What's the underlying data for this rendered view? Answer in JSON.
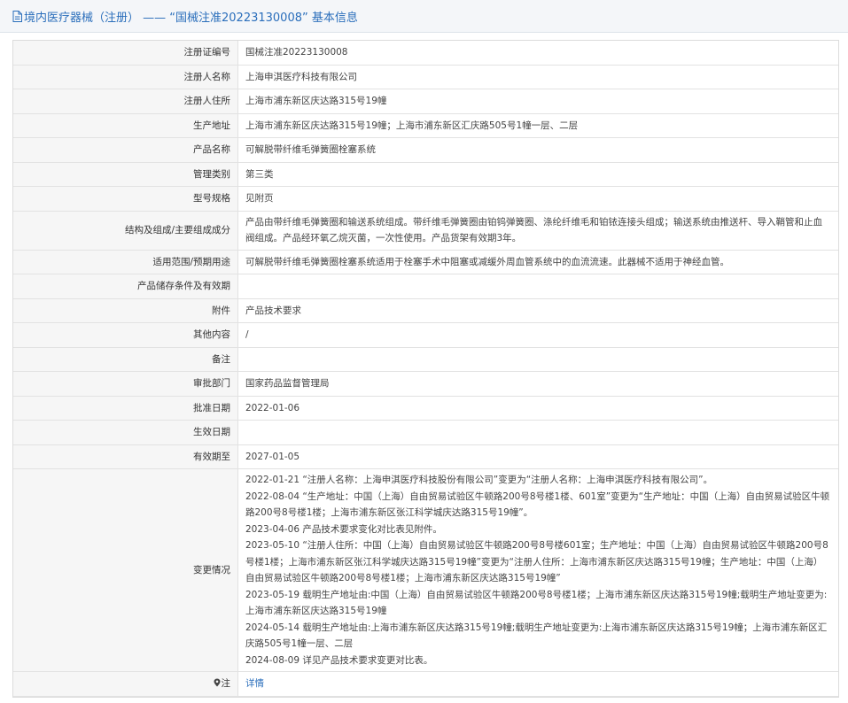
{
  "header": {
    "title": "境内医疗器械（注册） —— “国械注准20223130008” 基本信息"
  },
  "rows": [
    {
      "label": "注册证编号",
      "value": "国械注准20223130008"
    },
    {
      "label": "注册人名称",
      "value": "上海申淇医疗科技有限公司"
    },
    {
      "label": "注册人住所",
      "value": "上海市浦东新区庆达路315号19幢"
    },
    {
      "label": "生产地址",
      "value": "上海市浦东新区庆达路315号19幢；上海市浦东新区汇庆路505号1幢一层、二层"
    },
    {
      "label": "产品名称",
      "value": "可解脱带纤维毛弹簧圈栓塞系统"
    },
    {
      "label": "管理类别",
      "value": "第三类"
    },
    {
      "label": "型号规格",
      "value": "见附页"
    },
    {
      "label": "结构及组成/主要组成成分",
      "value": "产品由带纤维毛弹簧圈和输送系统组成。带纤维毛弹簧圈由铂钨弹簧圈、涤纶纤维毛和铂铱连接头组成；输送系统由推送杆、导入鞘管和止血阀组成。产品经环氧乙烷灭菌，一次性使用。产品货架有效期3年。"
    },
    {
      "label": "适用范围/预期用途",
      "value": "可解脱带纤维毛弹簧圈栓塞系统适用于栓塞手术中阻塞或减缓外周血管系统中的血流流速。此器械不适用于神经血管。"
    },
    {
      "label": "产品储存条件及有效期",
      "value": ""
    },
    {
      "label": "附件",
      "value": "产品技术要求"
    },
    {
      "label": "其他内容",
      "value": "/"
    },
    {
      "label": "备注",
      "value": ""
    },
    {
      "label": "审批部门",
      "value": "国家药品监督管理局"
    },
    {
      "label": "批准日期",
      "value": "2022-01-06"
    },
    {
      "label": "生效日期",
      "value": ""
    },
    {
      "label": "有效期至",
      "value": "2027-01-05"
    }
  ],
  "changes": {
    "label": "变更情况",
    "lines": [
      "2022-01-21 “注册人名称：上海申淇医疗科技股份有限公司”变更为“注册人名称：上海申淇医疗科技有限公司”。",
      "2022-08-04 “生产地址：中国（上海）自由贸易试验区牛顿路200号8号楼1楼、601室”变更为“生产地址：中国（上海）自由贸易试验区牛顿路200号8号楼1楼；上海市浦东新区张江科学城庆达路315号19幢”。",
      "2023-04-06 产品技术要求变化对比表见附件。",
      "2023-05-10 “注册人住所：中国（上海）自由贸易试验区牛顿路200号8号楼601室；生产地址：中国（上海）自由贸易试验区牛顿路200号8号楼1楼；上海市浦东新区张江科学城庆达路315号19幢”变更为“注册人住所：上海市浦东新区庆达路315号19幢；生产地址：中国（上海）自由贸易试验区牛顿路200号8号楼1楼；上海市浦东新区庆达路315号19幢”",
      "2023-05-19 载明生产地址由:中国（上海）自由贸易试验区牛顿路200号8号楼1楼；上海市浦东新区庆达路315号19幢;载明生产地址变更为:上海市浦东新区庆达路315号19幢",
      "2024-05-14 载明生产地址由:上海市浦东新区庆达路315号19幢;载明生产地址变更为:上海市浦东新区庆达路315号19幢；上海市浦东新区汇庆路505号1幢一层、二层",
      "2024-08-09 详见产品技术要求变更对比表。"
    ]
  },
  "note": {
    "label": "注",
    "link": "详情",
    "icon": "pin-icon"
  },
  "colors": {
    "accent": "#2a6ebb",
    "label_bg": "#f6f6f6",
    "border": "#e2e2e2"
  }
}
